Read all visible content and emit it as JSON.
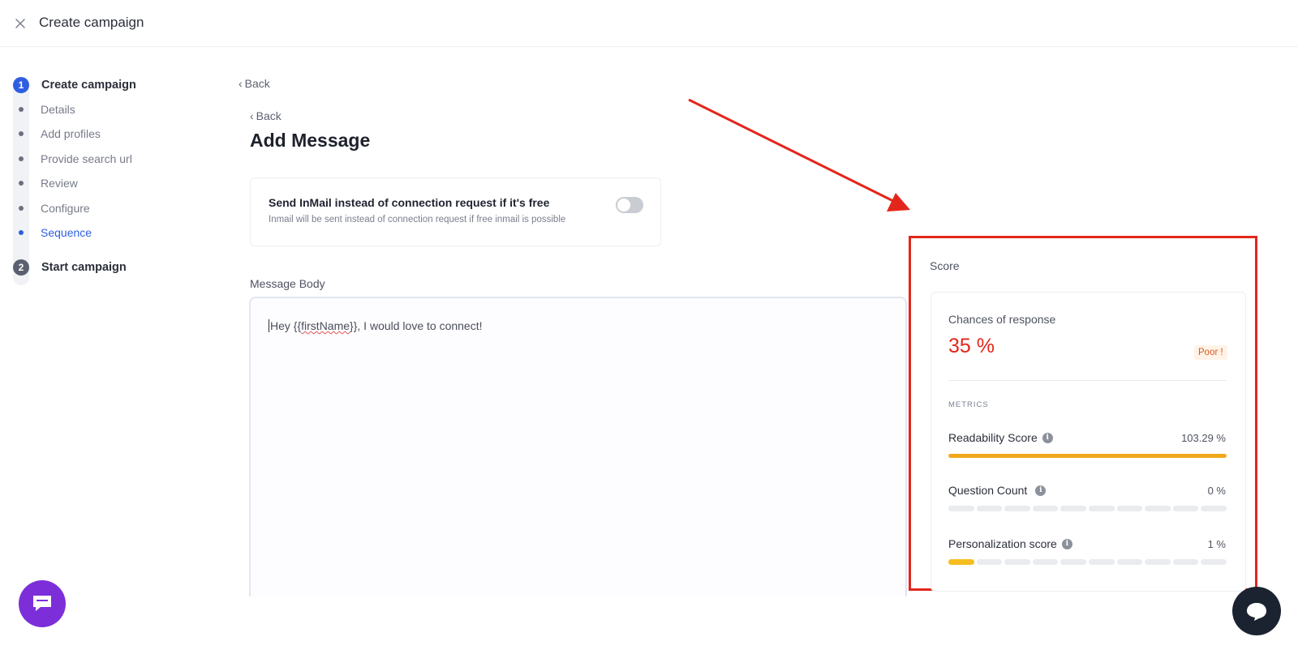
{
  "header": {
    "title": "Create campaign",
    "close_icon": "close-icon"
  },
  "stepper": {
    "steps": [
      {
        "number": "1",
        "label": "Create campaign"
      },
      {
        "number": "2",
        "label": "Start campaign"
      }
    ],
    "substeps": [
      "Details",
      "Add profiles",
      "Provide search url",
      "Review",
      "Configure",
      "Sequence"
    ],
    "current_substep": "Sequence"
  },
  "main": {
    "back_outer": "Back",
    "back_inner": "Back",
    "title": "Add Message",
    "inmail": {
      "title": "Send InMail instead of connection request if it's free",
      "subtitle": "Inmail will be sent instead of connection request if free inmail is possible",
      "enabled": false
    },
    "message_body_label": "Message Body",
    "message": {
      "prefix": "Hey {{",
      "variable": "firstName",
      "suffix": "}}, I would love to connect!"
    }
  },
  "score": {
    "title": "Score",
    "chances_label": "Chances of response",
    "chances_value": "35 %",
    "rating": "Poor !",
    "metrics_heading": "METRICS",
    "metrics": [
      {
        "name": "Readability Score",
        "value": "103.29 %",
        "fill": 1.0
      },
      {
        "name": "Question Count",
        "value": "0 %",
        "fill": 0
      },
      {
        "name": "Personalization score",
        "value": "1 %",
        "fill": 0.01
      }
    ]
  },
  "colors": {
    "accent": "#2f5fe0",
    "danger": "#e3261b",
    "warning": "#f0a91c",
    "chat": "#7c2fd9"
  }
}
